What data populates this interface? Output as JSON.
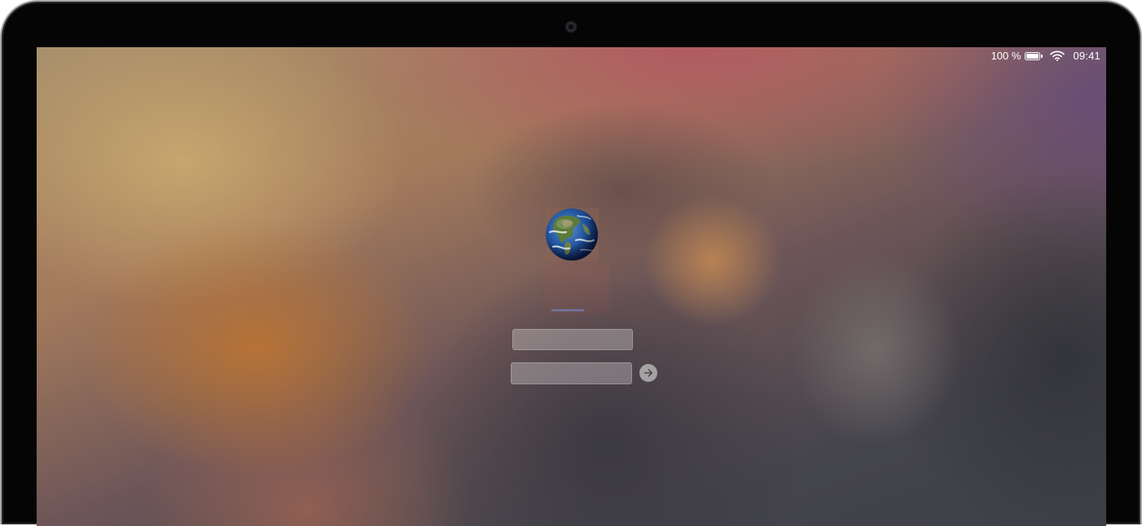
{
  "device": {
    "camera_icon": "camera-icon"
  },
  "status_bar": {
    "battery_text": "100 %",
    "battery_icon": "battery-icon",
    "battery_level": 1.0,
    "wifi_icon": "wifi-icon",
    "time": "09:41"
  },
  "login": {
    "avatar_icon": "globe-avatar",
    "submit_icon": "arrow-right-icon"
  },
  "colors": {
    "bezel": "#050505",
    "bezel_edge": "#a9a9a9",
    "status_text": "#ffffff",
    "field_bg": "rgba(255,255,255,0.28)",
    "wallpaper_yellow": "#ccac70",
    "wallpaper_orange": "#bc7432",
    "wallpaper_pink": "#b25862",
    "wallpaper_purple": "#684c78",
    "wallpaper_dark": "#3a3840"
  }
}
